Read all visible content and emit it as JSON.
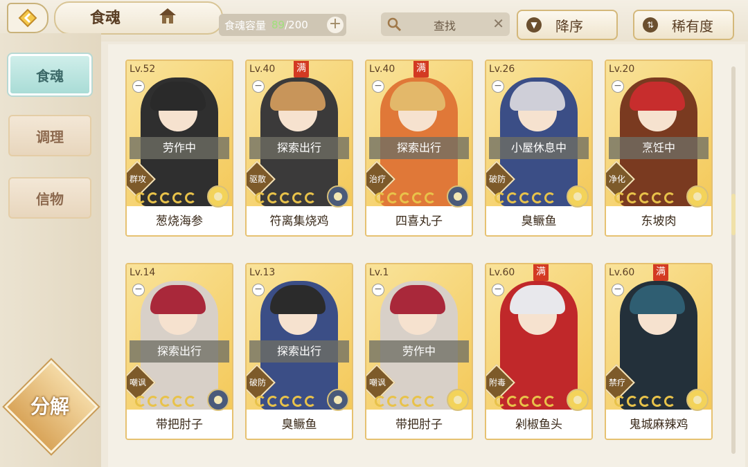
{
  "header": {
    "title": "食魂",
    "capacity_label": "食魂容量",
    "capacity_current": "89",
    "capacity_max": "/200",
    "add_label": "+",
    "search_label": "查找",
    "clear_label": "✕",
    "sort_desc_label": "降序",
    "sort_rarity_label": "稀有度"
  },
  "sidebar": {
    "items": [
      {
        "label": "食魂"
      },
      {
        "label": "调理"
      },
      {
        "label": "信物"
      }
    ],
    "decompose_label": "分解"
  },
  "full_label": "满",
  "cards": [
    {
      "level": "Lv.52",
      "full": false,
      "status": "劳作中",
      "role": "群攻",
      "stars": 5,
      "name": "葱烧海参",
      "hair": "#2a2a2a",
      "outfit": "#2f2f2f",
      "rarity": "gold"
    },
    {
      "level": "Lv.40",
      "full": true,
      "status": "探索出行",
      "role": "驱散",
      "stars": 5,
      "name": "符离集烧鸡",
      "hair": "#c8955a",
      "outfit": "#3b3a3a",
      "rarity": "blue"
    },
    {
      "level": "Lv.40",
      "full": true,
      "status": "探索出行",
      "role": "治疗",
      "stars": 5,
      "name": "四喜丸子",
      "hair": "#e3b86a",
      "outfit": "#e07838",
      "rarity": "blue"
    },
    {
      "level": "Lv.26",
      "full": false,
      "status": "小屋休息中",
      "role": "破防",
      "stars": 5,
      "name": "臭鳜鱼",
      "hair": "#cfcfd8",
      "outfit": "#3b4e86",
      "rarity": "gold"
    },
    {
      "level": "Lv.20",
      "full": false,
      "status": "烹饪中",
      "role": "净化",
      "stars": 5,
      "name": "东坡肉",
      "hair": "#c72d2d",
      "outfit": "#7a3a20",
      "rarity": "gold"
    },
    {
      "level": "Lv.14",
      "full": false,
      "status": "探索出行",
      "role": "嘲讽",
      "stars": 5,
      "name": "带把肘子",
      "hair": "#a9283a",
      "outfit": "#d8d0c8",
      "rarity": "blue"
    },
    {
      "level": "Lv.13",
      "full": false,
      "status": "探索出行",
      "role": "破防",
      "stars": 5,
      "name": "臭鳜鱼",
      "hair": "#2b2b2b",
      "outfit": "#3b4e86",
      "rarity": "blue"
    },
    {
      "level": "Lv.1",
      "full": false,
      "status": "劳作中",
      "role": "嘲讽",
      "stars": 5,
      "name": "带把肘子",
      "hair": "#a9283a",
      "outfit": "#d8d0c8",
      "rarity": "gold"
    },
    {
      "level": "Lv.60",
      "full": true,
      "status": "",
      "role": "附毒",
      "stars": 5,
      "name": "剁椒鱼头",
      "hair": "#e8e8ec",
      "outfit": "#c0282a",
      "rarity": "gold"
    },
    {
      "level": "Lv.60",
      "full": true,
      "status": "",
      "role": "禁疗",
      "stars": 5,
      "name": "鬼城麻辣鸡",
      "hair": "#2f5e72",
      "outfit": "#23303a",
      "rarity": "gold"
    }
  ]
}
